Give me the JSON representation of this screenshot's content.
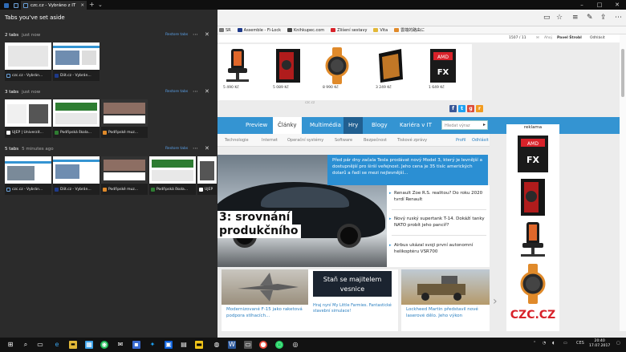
{
  "titlebar": {
    "tab1": {
      "label": "czc.cz - Vybráno z IT"
    },
    "new_tab": "+",
    "tab_list": "⌄"
  },
  "favorites": [
    "SR",
    "Assemble - Fi-Lock",
    "Knihkupec.com",
    "Zlišení sestavy",
    "Vita",
    "雲端的路由に"
  ],
  "aside_panel": {
    "title": "Tabs you've set aside",
    "restore_label": "Restore tabs",
    "groups": [
      {
        "count": "2 tabs",
        "ago": "just now",
        "tabs": [
          "czc.cz - Vybrán...",
          "Diit.cz - Vybrán..."
        ]
      },
      {
        "count": "3 tabs",
        "ago": "just now",
        "tabs": [
          "UJEP | Univerzit...",
          "Podřipská škola...",
          "Podřipské muz..."
        ]
      },
      {
        "count": "5 tabs",
        "ago": "5 minutes ago",
        "tabs": [
          "czc.cz - Vybrán...",
          "Diit.cz - Vybrán...",
          "Podřipské muz...",
          "Podřipská škola...",
          "UJEP"
        ]
      }
    ]
  },
  "page": {
    "userbar": {
      "counter": "1507 / 11",
      "user_prefix": "Ahoj",
      "user": "Pavel Štrobl",
      "logout": "Odhlásit"
    },
    "ad_prices": [
      "5 490 Kč",
      "5 089 Kč",
      "8 990 Kč",
      "3 249 Kč",
      "1 649 Kč"
    ],
    "ad_caption": "czc.cz",
    "nav": [
      "Preview",
      "Články",
      "Multimédia",
      "Hry",
      "Blogy",
      "Kariéra v IT"
    ],
    "search_placeholder": "Hledat výraz",
    "subnav": [
      "Technologie",
      "Internet",
      "Operační systémy",
      "Software",
      "Bezpečnost",
      "Tiskové zprávy"
    ],
    "profile": "Profil",
    "logout": "Odhlásit",
    "hero_lines": [
      "3: srovnání",
      "produkčního"
    ],
    "hero_caption": "Před pár dny začala Tesla prodávat nový Model 3, který je levnější a dostupnější pro širší veřejnost. Jeho cena je 35 tisíc amerických dolarů a řadí se mezi nejlevnější...",
    "stories": [
      "Renault Zoe R.S. realitou? Do roku 2020 tvrdí Renault",
      "Nový ruský supertank T-14. Dokáží tanky NATO probít jeho pancíř?",
      "Airbus ukázal svoji první autonomní helikoptéru VSR700"
    ],
    "lower": {
      "left_caption": "Modernizované F-15 jako raketová podpora stíhacích...",
      "callout_title": "Staň se majitelem vesnice",
      "callout_sub": "Hraj nyní My Little Farmies. Fantastické stavební simulace!",
      "right_caption": "Lockheed Martin představil nové laserové dělo. Jeho výkon"
    },
    "side_ad_label": "reklama",
    "side_ad_logo": "CZC.CZ"
  },
  "taskbar": {
    "language": "CES",
    "time": "20:40",
    "date": "17.07.2017"
  },
  "colors": {
    "accent": "#3494d2",
    "panel": "#2b2b2b",
    "restore": "#5aa0e8",
    "brand": "#d8222a"
  },
  "icons": [
    "back-icon",
    "forward-icon",
    "refresh-icon",
    "home-icon",
    "reading-view-icon",
    "favorite-star-icon",
    "hub-icon",
    "notes-icon",
    "share-icon",
    "more-icon",
    "windows-start-icon",
    "search-icon",
    "task-view-icon"
  ]
}
